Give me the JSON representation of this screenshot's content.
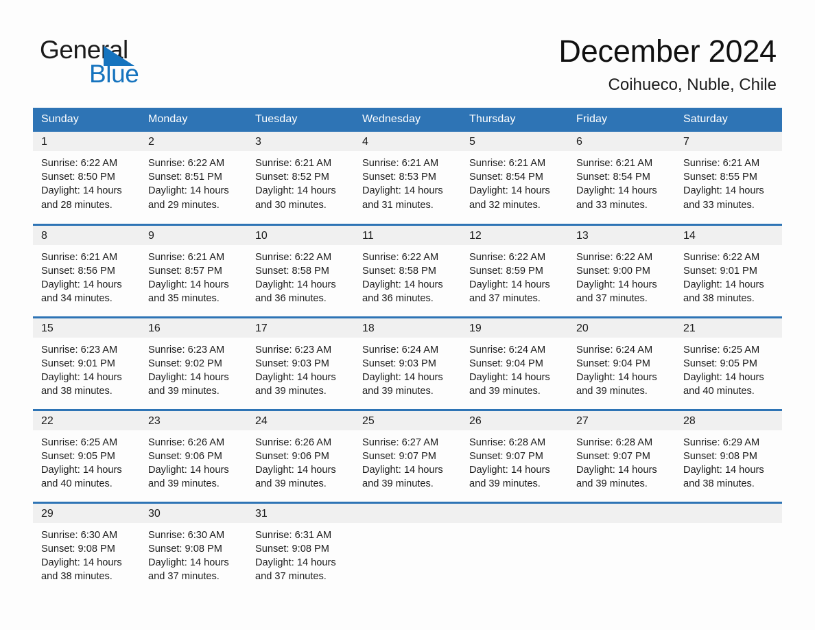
{
  "brand": {
    "name_part1": "General",
    "name_part2": "Blue",
    "flag_icon": "blue-triangle-flag-icon",
    "accent_color": "#1573be"
  },
  "header": {
    "title": "December 2024",
    "subtitle": "Coihueco, Nuble, Chile"
  },
  "theme": {
    "header_blue": "#2e74b5",
    "daynum_band": "#f0f0f0",
    "page_background": "#fdfdfd",
    "text_color": "#1b1b1b"
  },
  "calendar": {
    "weekday_headers": [
      "Sunday",
      "Monday",
      "Tuesday",
      "Wednesday",
      "Thursday",
      "Friday",
      "Saturday"
    ],
    "weeks": [
      [
        {
          "day": "1",
          "sunrise": "Sunrise: 6:22 AM",
          "sunset": "Sunset: 8:50 PM",
          "daylight_line1": "Daylight: 14 hours",
          "daylight_line2": "and 28 minutes."
        },
        {
          "day": "2",
          "sunrise": "Sunrise: 6:22 AM",
          "sunset": "Sunset: 8:51 PM",
          "daylight_line1": "Daylight: 14 hours",
          "daylight_line2": "and 29 minutes."
        },
        {
          "day": "3",
          "sunrise": "Sunrise: 6:21 AM",
          "sunset": "Sunset: 8:52 PM",
          "daylight_line1": "Daylight: 14 hours",
          "daylight_line2": "and 30 minutes."
        },
        {
          "day": "4",
          "sunrise": "Sunrise: 6:21 AM",
          "sunset": "Sunset: 8:53 PM",
          "daylight_line1": "Daylight: 14 hours",
          "daylight_line2": "and 31 minutes."
        },
        {
          "day": "5",
          "sunrise": "Sunrise: 6:21 AM",
          "sunset": "Sunset: 8:54 PM",
          "daylight_line1": "Daylight: 14 hours",
          "daylight_line2": "and 32 minutes."
        },
        {
          "day": "6",
          "sunrise": "Sunrise: 6:21 AM",
          "sunset": "Sunset: 8:54 PM",
          "daylight_line1": "Daylight: 14 hours",
          "daylight_line2": "and 33 minutes."
        },
        {
          "day": "7",
          "sunrise": "Sunrise: 6:21 AM",
          "sunset": "Sunset: 8:55 PM",
          "daylight_line1": "Daylight: 14 hours",
          "daylight_line2": "and 33 minutes."
        }
      ],
      [
        {
          "day": "8",
          "sunrise": "Sunrise: 6:21 AM",
          "sunset": "Sunset: 8:56 PM",
          "daylight_line1": "Daylight: 14 hours",
          "daylight_line2": "and 34 minutes."
        },
        {
          "day": "9",
          "sunrise": "Sunrise: 6:21 AM",
          "sunset": "Sunset: 8:57 PM",
          "daylight_line1": "Daylight: 14 hours",
          "daylight_line2": "and 35 minutes."
        },
        {
          "day": "10",
          "sunrise": "Sunrise: 6:22 AM",
          "sunset": "Sunset: 8:58 PM",
          "daylight_line1": "Daylight: 14 hours",
          "daylight_line2": "and 36 minutes."
        },
        {
          "day": "11",
          "sunrise": "Sunrise: 6:22 AM",
          "sunset": "Sunset: 8:58 PM",
          "daylight_line1": "Daylight: 14 hours",
          "daylight_line2": "and 36 minutes."
        },
        {
          "day": "12",
          "sunrise": "Sunrise: 6:22 AM",
          "sunset": "Sunset: 8:59 PM",
          "daylight_line1": "Daylight: 14 hours",
          "daylight_line2": "and 37 minutes."
        },
        {
          "day": "13",
          "sunrise": "Sunrise: 6:22 AM",
          "sunset": "Sunset: 9:00 PM",
          "daylight_line1": "Daylight: 14 hours",
          "daylight_line2": "and 37 minutes."
        },
        {
          "day": "14",
          "sunrise": "Sunrise: 6:22 AM",
          "sunset": "Sunset: 9:01 PM",
          "daylight_line1": "Daylight: 14 hours",
          "daylight_line2": "and 38 minutes."
        }
      ],
      [
        {
          "day": "15",
          "sunrise": "Sunrise: 6:23 AM",
          "sunset": "Sunset: 9:01 PM",
          "daylight_line1": "Daylight: 14 hours",
          "daylight_line2": "and 38 minutes."
        },
        {
          "day": "16",
          "sunrise": "Sunrise: 6:23 AM",
          "sunset": "Sunset: 9:02 PM",
          "daylight_line1": "Daylight: 14 hours",
          "daylight_line2": "and 39 minutes."
        },
        {
          "day": "17",
          "sunrise": "Sunrise: 6:23 AM",
          "sunset": "Sunset: 9:03 PM",
          "daylight_line1": "Daylight: 14 hours",
          "daylight_line2": "and 39 minutes."
        },
        {
          "day": "18",
          "sunrise": "Sunrise: 6:24 AM",
          "sunset": "Sunset: 9:03 PM",
          "daylight_line1": "Daylight: 14 hours",
          "daylight_line2": "and 39 minutes."
        },
        {
          "day": "19",
          "sunrise": "Sunrise: 6:24 AM",
          "sunset": "Sunset: 9:04 PM",
          "daylight_line1": "Daylight: 14 hours",
          "daylight_line2": "and 39 minutes."
        },
        {
          "day": "20",
          "sunrise": "Sunrise: 6:24 AM",
          "sunset": "Sunset: 9:04 PM",
          "daylight_line1": "Daylight: 14 hours",
          "daylight_line2": "and 39 minutes."
        },
        {
          "day": "21",
          "sunrise": "Sunrise: 6:25 AM",
          "sunset": "Sunset: 9:05 PM",
          "daylight_line1": "Daylight: 14 hours",
          "daylight_line2": "and 40 minutes."
        }
      ],
      [
        {
          "day": "22",
          "sunrise": "Sunrise: 6:25 AM",
          "sunset": "Sunset: 9:05 PM",
          "daylight_line1": "Daylight: 14 hours",
          "daylight_line2": "and 40 minutes."
        },
        {
          "day": "23",
          "sunrise": "Sunrise: 6:26 AM",
          "sunset": "Sunset: 9:06 PM",
          "daylight_line1": "Daylight: 14 hours",
          "daylight_line2": "and 39 minutes."
        },
        {
          "day": "24",
          "sunrise": "Sunrise: 6:26 AM",
          "sunset": "Sunset: 9:06 PM",
          "daylight_line1": "Daylight: 14 hours",
          "daylight_line2": "and 39 minutes."
        },
        {
          "day": "25",
          "sunrise": "Sunrise: 6:27 AM",
          "sunset": "Sunset: 9:07 PM",
          "daylight_line1": "Daylight: 14 hours",
          "daylight_line2": "and 39 minutes."
        },
        {
          "day": "26",
          "sunrise": "Sunrise: 6:28 AM",
          "sunset": "Sunset: 9:07 PM",
          "daylight_line1": "Daylight: 14 hours",
          "daylight_line2": "and 39 minutes."
        },
        {
          "day": "27",
          "sunrise": "Sunrise: 6:28 AM",
          "sunset": "Sunset: 9:07 PM",
          "daylight_line1": "Daylight: 14 hours",
          "daylight_line2": "and 39 minutes."
        },
        {
          "day": "28",
          "sunrise": "Sunrise: 6:29 AM",
          "sunset": "Sunset: 9:08 PM",
          "daylight_line1": "Daylight: 14 hours",
          "daylight_line2": "and 38 minutes."
        }
      ],
      [
        {
          "day": "29",
          "sunrise": "Sunrise: 6:30 AM",
          "sunset": "Sunset: 9:08 PM",
          "daylight_line1": "Daylight: 14 hours",
          "daylight_line2": "and 38 minutes."
        },
        {
          "day": "30",
          "sunrise": "Sunrise: 6:30 AM",
          "sunset": "Sunset: 9:08 PM",
          "daylight_line1": "Daylight: 14 hours",
          "daylight_line2": "and 37 minutes."
        },
        {
          "day": "31",
          "sunrise": "Sunrise: 6:31 AM",
          "sunset": "Sunset: 9:08 PM",
          "daylight_line1": "Daylight: 14 hours",
          "daylight_line2": "and 37 minutes."
        },
        {
          "day": "",
          "sunrise": "",
          "sunset": "",
          "daylight_line1": "",
          "daylight_line2": ""
        },
        {
          "day": "",
          "sunrise": "",
          "sunset": "",
          "daylight_line1": "",
          "daylight_line2": ""
        },
        {
          "day": "",
          "sunrise": "",
          "sunset": "",
          "daylight_line1": "",
          "daylight_line2": ""
        },
        {
          "day": "",
          "sunrise": "",
          "sunset": "",
          "daylight_line1": "",
          "daylight_line2": ""
        }
      ]
    ]
  }
}
